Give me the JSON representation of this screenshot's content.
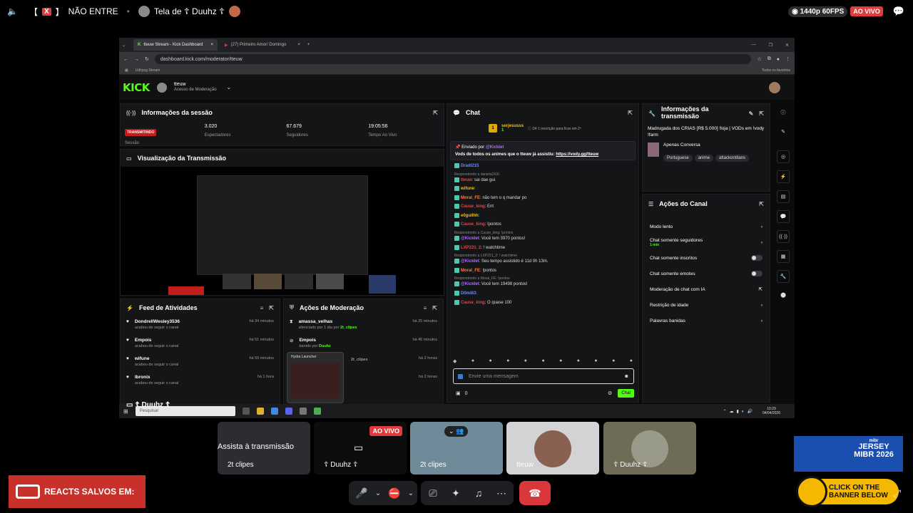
{
  "topbar": {
    "channel_tag": "X",
    "channel_name": "NÃO ENTRE",
    "screen_title": "Tela de ☦ Duuhz ☦",
    "quality": "1440p 60FPS",
    "live_badge": "AO VIVO"
  },
  "browser": {
    "tabs": [
      {
        "label": "tteuw Stream - Kick Dashboard",
        "active": true
      },
      {
        "label": "(27) Primeiro Amor/ Domingo",
        "active": false
      }
    ],
    "url": "dashboard.kick.com/moderator/tteuw",
    "bookmark": "Udhyog Stream",
    "all_favorites": "Todos os favoritos"
  },
  "kick": {
    "logo": "KICK",
    "beta": "beta",
    "user": "tteuw",
    "user_role": "Acesso de Moderação",
    "session": {
      "title": "Informações da sessão",
      "status_badge": "TRANSMITINDO",
      "status_label": "Sessão",
      "stats": [
        {
          "value": "3.020",
          "label": "Espectadores"
        },
        {
          "value": "67.679",
          "label": "Seguidores"
        },
        {
          "value": "19:05:56",
          "label": "Tempo Ao Vivo"
        }
      ]
    },
    "preview_title": "Visualização da Transmissão",
    "feed": {
      "title": "Feed de Atividades",
      "items": [
        {
          "name": "DondrellWesley3536",
          "action": "acabou de seguir o canal",
          "time": "há 34 minutos"
        },
        {
          "name": "Empois",
          "action": "acabou de seguir o canal",
          "time": "há 51 minutos"
        },
        {
          "name": "wifune",
          "action": "acabou de seguir o canal",
          "time": "há 59 minutos"
        },
        {
          "name": "lbronix",
          "action": "acabou de seguir o canal",
          "time": "há 1 hora"
        }
      ]
    },
    "moderation": {
      "title": "Ações de Moderação",
      "items": [
        {
          "name": "amassa_velhas",
          "action": "silenciado por 1 dia por",
          "by": "2t_clipes",
          "time": "há 25 minutos"
        },
        {
          "name": "Empois",
          "action": "banido por",
          "by": "Duuhz",
          "time": "há 45 minutos"
        },
        {
          "name": "",
          "action": "",
          "by": "2t_clipes",
          "time": "há 2 horas"
        },
        {
          "name": "",
          "action": "",
          "by": "",
          "time": "há 2 horas"
        }
      ],
      "popup_title": "Hydra Launcher"
    },
    "chat": {
      "title": "Chat",
      "top_user": "serjesusss",
      "top_count": "1",
      "top_info": "Dê 1 inscrição para ficar em 2º",
      "pinned_by": "Enviado por",
      "pinned_user": "@Kicklet",
      "pinned_text": "Vods de todos os animes que o tteuw já assistiu:",
      "pinned_link": "https://vody.gg/tteuw",
      "lines": [
        {
          "reply": "",
          "user": "Dradi215",
          "color": "u-blue",
          "text": ""
        },
        {
          "reply": "Respondendo a daniela2t16:",
          "user": "tteuw",
          "color": "u-red",
          "text": ": sai dae gui"
        },
        {
          "reply": "",
          "user": "wifune",
          "color": "u-yellow",
          "text": ":"
        },
        {
          "reply": "",
          "user": "Moral_FE",
          "color": "u-orange",
          "text": ": não tem o q mandar po"
        },
        {
          "reply": "",
          "user": "Cause_king",
          "color": "u-red",
          "text": ": Ent"
        },
        {
          "reply": "",
          "user": "e0guilhh",
          "color": "u-yellow",
          "text": ":"
        },
        {
          "reply": "",
          "user": "Cause_king",
          "color": "u-red",
          "text": ": !pontos"
        },
        {
          "reply": "Respondendo a Cause_king: !pontos",
          "user": "@Kicklet",
          "color": "u-purple",
          "text": ": Você tem 3970 pontos!"
        },
        {
          "reply": "",
          "user": "LXP221_2",
          "color": "u-red",
          "text": ": ! watchtime"
        },
        {
          "reply": "Respondendo a LXP221_2: ! watchtime",
          "user": "@Kicklet",
          "color": "u-purple",
          "text": ": Seu tempo assistido é 11d 0h 13m."
        },
        {
          "reply": "",
          "user": "Moral_FE",
          "color": "u-orange",
          "text": ": !pontos"
        },
        {
          "reply": "Respondendo a Moral_FE: !pontos",
          "user": "@Kicklet",
          "color": "u-purple",
          "text": ": Você tem 19498 pontos!"
        },
        {
          "reply": "",
          "user": "D0mi83",
          "color": "u-blue",
          "text": ":"
        },
        {
          "reply": "",
          "user": "Cause_king",
          "color": "u-red",
          "text": ": Ó quase 100"
        }
      ],
      "input_placeholder": "Envie uma mensagem",
      "count": "0",
      "send_label": "Chat"
    },
    "info": {
      "title": "Informações da transmissão",
      "stream_title": "Madrugada dos CRIAS [R$ 5.000] !loja | VODs em !vody !farm",
      "category": "Apenas Conversa",
      "tags": [
        "Portuguese",
        "anime",
        "attackontitans"
      ]
    },
    "actions": {
      "title": "Ações do Canal",
      "items": [
        {
          "label": "Modo lento",
          "sub": "",
          "control": "chevron"
        },
        {
          "label": "Chat somente seguidores",
          "sub": "1 min",
          "control": "chevron"
        },
        {
          "label": "Chat somente inscritos",
          "sub": "",
          "control": "toggle"
        },
        {
          "label": "Chat somente emotes",
          "sub": "",
          "control": "toggle"
        },
        {
          "label": "Moderação de chat com IA",
          "sub": "",
          "control": "external"
        },
        {
          "label": "Restrição de idade",
          "sub": "",
          "control": "chevron"
        },
        {
          "label": "Palavras banidas",
          "sub": "",
          "control": "chevron"
        }
      ]
    }
  },
  "taskbar": {
    "overlay_name": "☦ Duuhz ☦",
    "search": "Pesquisar",
    "time": "10:29",
    "date": "04/04/2026"
  },
  "tiles": [
    {
      "label": "Assista à transmissão",
      "sub": "2t clipes"
    },
    {
      "label": "☦ Duuhz ☦",
      "badge": "AO VIVO"
    },
    {
      "label": "2t clipes"
    },
    {
      "label": "tteuw"
    },
    {
      "label": "☦ Duuhz ☦"
    }
  ],
  "overlays": {
    "reacts": "REACTS SALVOS EM:",
    "ad_title": "JERSEY MIBR 2026",
    "ad_brand": "mibr",
    "ad_cta": "CLICK ON THE BANNER BELOW"
  },
  "colors": {
    "kick_green": "#53fc18",
    "live_red": "#e23b3b",
    "discord_dark": "#1e1f22",
    "end_call_red": "#da373c"
  }
}
